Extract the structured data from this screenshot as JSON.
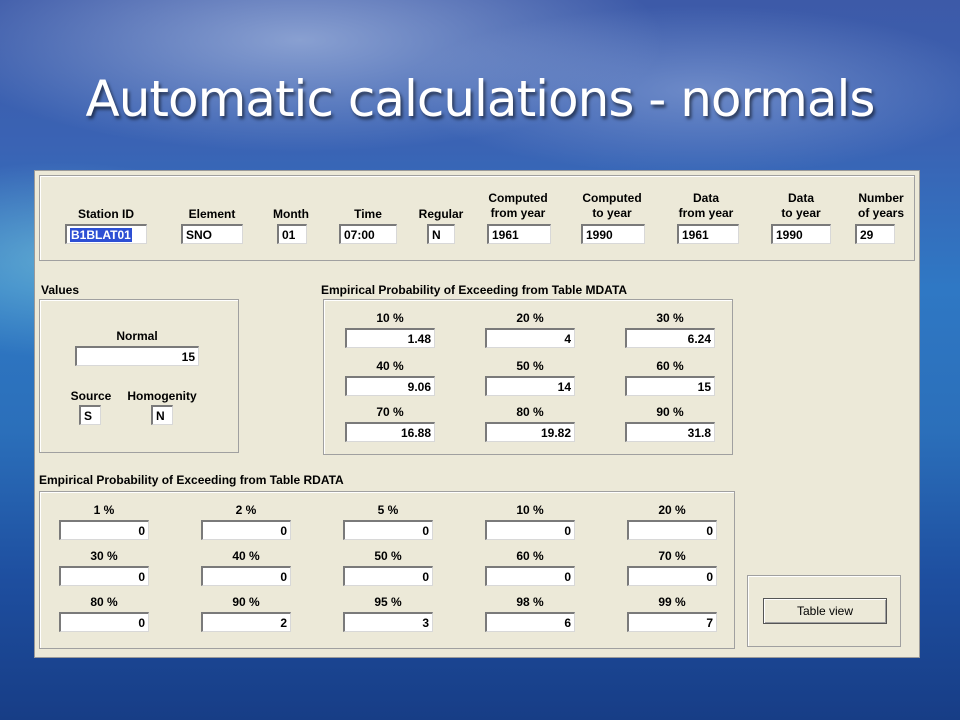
{
  "slide_title": "Automatic calculations - normals",
  "station": {
    "labels": [
      "Station ID",
      "Element",
      "Month",
      "Time",
      "Regular",
      "Computed\nfrom year",
      "Computed\nto year",
      "Data\nfrom year",
      "Data\nto year",
      "Number\nof years"
    ],
    "values": [
      "B1BLAT01",
      "SNO",
      "01",
      "07:00",
      "N",
      "1961",
      "1990",
      "1961",
      "1990",
      "29"
    ]
  },
  "values_group": {
    "header": "Values",
    "normal_label": "Normal",
    "normal_value": "15",
    "source_label": "Source",
    "source_value": "S",
    "homogenity_label": "Homogenity",
    "homogenity_value": "N"
  },
  "mdata": {
    "header": "Empirical Probability of Exceeding from Table MDATA",
    "labels": [
      "10 %",
      "20 %",
      "30 %",
      "40 %",
      "50 %",
      "60 %",
      "70 %",
      "80 %",
      "90 %"
    ],
    "values": [
      "1.48",
      "4",
      "6.24",
      "9.06",
      "14",
      "15",
      "16.88",
      "19.82",
      "31.8"
    ]
  },
  "rdata": {
    "header": "Empirical Probability of Exceeding from Table RDATA",
    "labels": [
      "1 %",
      "2 %",
      "5 %",
      "10 %",
      "20 %",
      "30 %",
      "40 %",
      "50 %",
      "60 %",
      "70 %",
      "80 %",
      "90 %",
      "95 %",
      "98 %",
      "99 %"
    ],
    "values": [
      "0",
      "0",
      "0",
      "0",
      "0",
      "0",
      "0",
      "0",
      "0",
      "0",
      "0",
      "2",
      "3",
      "6",
      "7"
    ]
  },
  "table_view_label": "Table view"
}
